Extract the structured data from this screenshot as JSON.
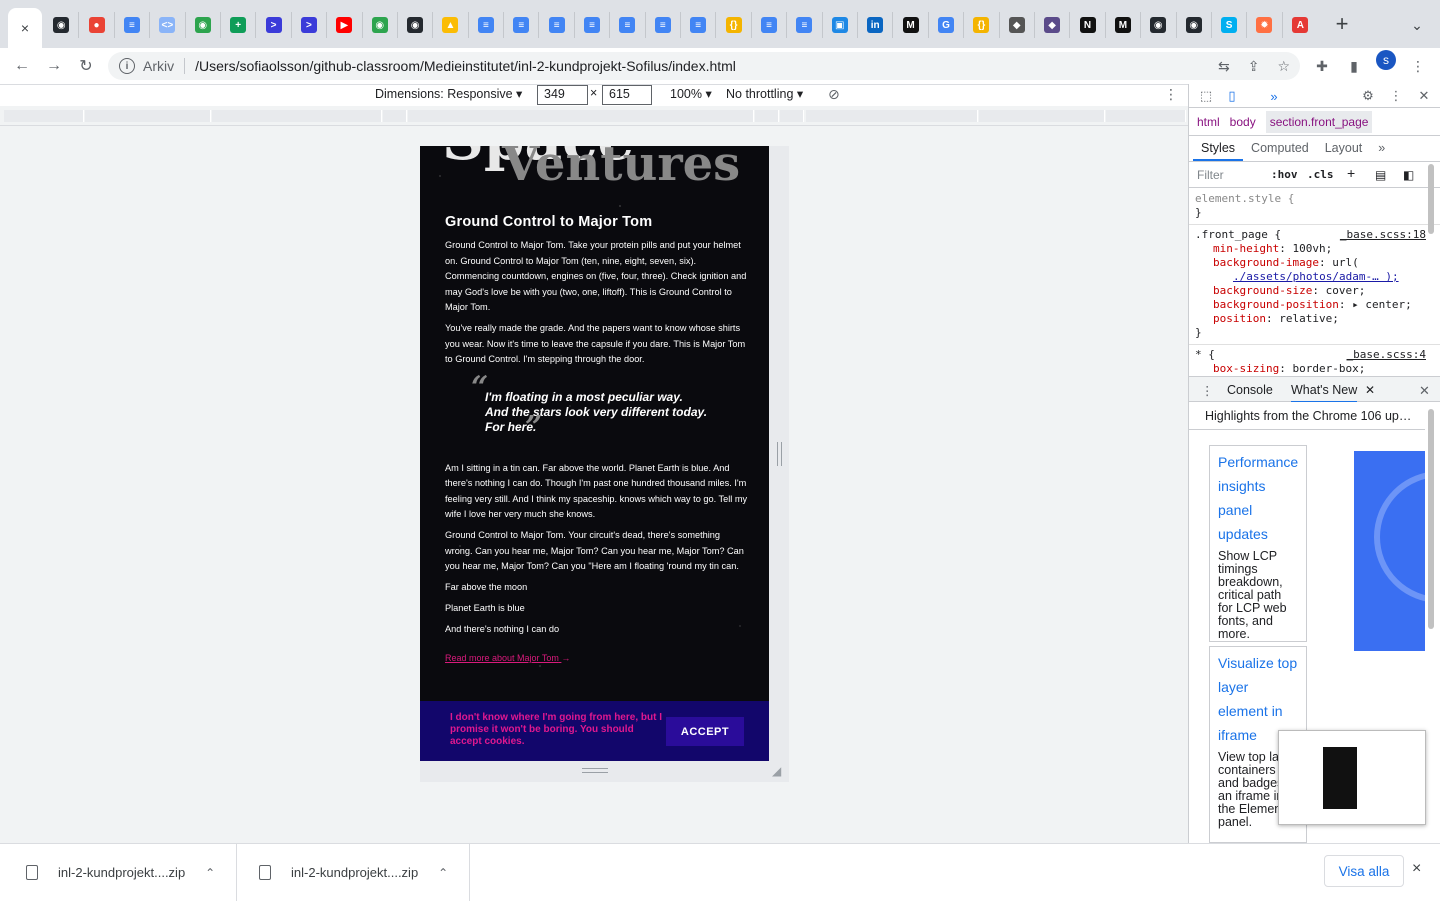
{
  "browser": {
    "active_tab_close": "×",
    "new_tab": "+",
    "tab_search": "⌄",
    "favicons": [
      {
        "name": "github-icon",
        "color": "#24292f",
        "glyph": "◉"
      },
      {
        "name": "map-pin-icon",
        "color": "#ea4335",
        "glyph": "●"
      },
      {
        "name": "docs-icon",
        "color": "#4285f4",
        "glyph": "≡"
      },
      {
        "name": "code-icon",
        "color": "#8ab4f8",
        "glyph": "<>"
      },
      {
        "name": "github-classroom-icon",
        "color": "#2da44e",
        "glyph": "◉"
      },
      {
        "name": "sheets-icon",
        "color": "#0f9d58",
        "glyph": "+"
      },
      {
        "name": "terminal-icon",
        "color": "#3b3bd9",
        "glyph": ">"
      },
      {
        "name": "terminal-icon",
        "color": "#3b3bd9",
        "glyph": ">"
      },
      {
        "name": "youtube-icon",
        "color": "#ff0000",
        "glyph": "▶"
      },
      {
        "name": "github-classroom-icon",
        "color": "#2da44e",
        "glyph": "◉"
      },
      {
        "name": "github-icon",
        "color": "#24292f",
        "glyph": "◉"
      },
      {
        "name": "drive-icon",
        "color": "#fbbc04",
        "glyph": "▲"
      },
      {
        "name": "docs-icon",
        "color": "#4285f4",
        "glyph": "≡"
      },
      {
        "name": "docs-icon",
        "color": "#4285f4",
        "glyph": "≡"
      },
      {
        "name": "docs-icon",
        "color": "#4285f4",
        "glyph": "≡"
      },
      {
        "name": "docs-icon",
        "color": "#4285f4",
        "glyph": "≡"
      },
      {
        "name": "docs-icon",
        "color": "#4285f4",
        "glyph": "≡"
      },
      {
        "name": "docs-icon",
        "color": "#4285f4",
        "glyph": "≡"
      },
      {
        "name": "docs-icon",
        "color": "#4285f4",
        "glyph": "≡"
      },
      {
        "name": "json-icon",
        "color": "#f4b400",
        "glyph": "{}"
      },
      {
        "name": "docs-icon",
        "color": "#4285f4",
        "glyph": "≡"
      },
      {
        "name": "docs-icon",
        "color": "#4285f4",
        "glyph": "≡"
      },
      {
        "name": "stack-icon",
        "color": "#1e88e5",
        "glyph": "▣"
      },
      {
        "name": "linkedin-icon",
        "color": "#0a66c2",
        "glyph": "in"
      },
      {
        "name": "medium-icon",
        "color": "#111111",
        "glyph": "M"
      },
      {
        "name": "google-icon",
        "color": "#4285f4",
        "glyph": "G"
      },
      {
        "name": "json-icon",
        "color": "#f4b400",
        "glyph": "{}"
      },
      {
        "name": "eraser-icon",
        "color": "#555555",
        "glyph": "◆"
      },
      {
        "name": "mascot-icon",
        "color": "#5b4b8a",
        "glyph": "◆"
      },
      {
        "name": "notion-icon",
        "color": "#111111",
        "glyph": "N"
      },
      {
        "name": "medium-icon",
        "color": "#111111",
        "glyph": "M"
      },
      {
        "name": "github-icon",
        "color": "#24292f",
        "glyph": "◉"
      },
      {
        "name": "github-icon",
        "color": "#24292f",
        "glyph": "◉"
      },
      {
        "name": "skype-icon",
        "color": "#00aff0",
        "glyph": "S"
      },
      {
        "name": "settings-orange-icon",
        "color": "#ff7043",
        "glyph": "✹"
      },
      {
        "name": "pdf-icon",
        "color": "#e53935",
        "glyph": "A"
      }
    ],
    "address": {
      "scheme_label": "Arkiv",
      "url": "/Users/sofiaolsson/github-classroom/Medieinstitutet/inl-2-kundprojekt-Sofilus/index.html"
    },
    "profile_initial": "s"
  },
  "device_toolbar": {
    "dimensions_label": "Dimensions: Responsive ▾",
    "width": "349",
    "times": "×",
    "height": "615",
    "zoom": "100% ▾",
    "throttling": "No throttling ▾"
  },
  "page": {
    "hero_line1": "Space",
    "hero_line2": "Ventures",
    "heading": "Ground Control to Major Tom",
    "paragraphs_top": [
      "Ground Control to Major Tom. Take your protein pills and put your helmet on. Ground Control to Major Tom (ten, nine, eight, seven, six). Commencing countdown, engines on (five, four, three). Check ignition and may God's love be with you (two, one, liftoff). This is Ground Control to Major Tom.",
      "You've really made the grade. And the papers want to know whose shirts you wear. Now it's time to leave the capsule if you dare. This is Major Tom to Ground Control. I'm stepping through the door."
    ],
    "quote_lines": [
      "I'm floating in a most peculiar way.",
      "And the stars look very different today.",
      "For here."
    ],
    "paragraphs_bottom": [
      "Am I sitting in a tin can. Far above the world. Planet Earth is blue. And there's nothing I can do. Though I'm past one hundred thousand miles. I'm feeling very still. And I think my spaceship. knows which way to go. Tell my wife I love her very much she knows.",
      "Ground Control to Major Tom. Your circuit's dead, there's something wrong. Can you hear me, Major Tom? Can you hear me, Major Tom? Can you hear me, Major Tom? Can you \"Here am I floating 'round my tin can.",
      "Far above the moon",
      "Planet Earth is blue",
      "And there's nothing I can do"
    ],
    "read_more": "Read more about Major Tom",
    "read_more_arrow": "→",
    "cookie_text": "I don't know where I'm going from here, but I promise it won't be boring. You should accept cookies.",
    "accept_label": "ACCEPT",
    "colors": {
      "accent_pink": "#e0188f",
      "cookie_bg": "#12066b",
      "accept_bg": "#2a0c9a"
    }
  },
  "devtools": {
    "panel_chevron": "»",
    "breadcrumbs": [
      "html",
      "body",
      "section.front_page"
    ],
    "subtabs": [
      "Styles",
      "Computed",
      "Layout",
      "»"
    ],
    "filter_placeholder": "Filter",
    "hov": ":hov",
    "cls": ".cls",
    "rules": {
      "element_style_open": "element.style {",
      "close": "}",
      "front_selector": ".front_page {",
      "front_source": "_base.scss:18",
      "front_props": [
        {
          "prop": "min-height",
          "val": "100vh;"
        },
        {
          "prop": "background-image",
          "val": "url("
        },
        {
          "prop": "",
          "val": "./assets/photos/adam-… );"
        },
        {
          "prop": "background-size",
          "val": "cover;"
        },
        {
          "prop": "background-position",
          "val": "▸ center;"
        },
        {
          "prop": "position",
          "val": "relative;"
        }
      ],
      "star_selector": "* {",
      "star_source": "_base.scss:4",
      "star_prop": "box-sizing",
      "star_val": "border-box;"
    },
    "drawer": {
      "console_label": "Console",
      "whatsnew_label": "What's New",
      "headline": "Highlights from the Chrome 106 up…",
      "cards": [
        {
          "title": "Performance insights panel updates",
          "desc": "Show LCP timings breakdown, critical path for LCP web fonts, and more."
        },
        {
          "title": "Visualize top layer element in iframe",
          "desc": "View top layer containers and badges of an iframe in the Elements panel."
        }
      ]
    }
  },
  "downloads": {
    "items": [
      "inl-2-kundprojekt....zip",
      "inl-2-kundprojekt....zip"
    ],
    "show_all": "Visa alla",
    "close": "×"
  }
}
